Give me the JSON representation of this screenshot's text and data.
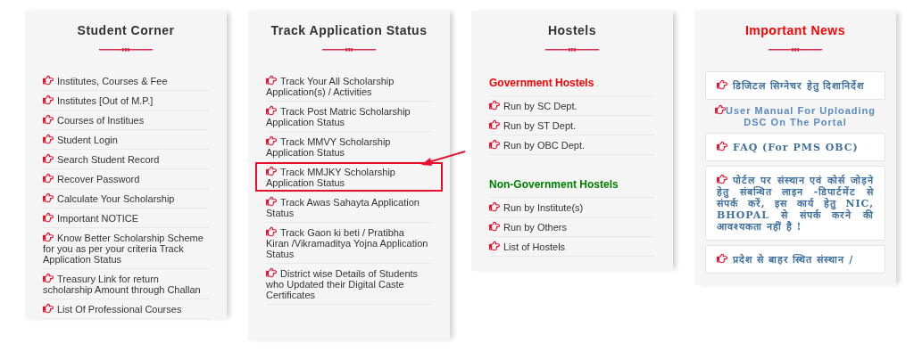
{
  "panels": [
    {
      "title": "Student Corner",
      "title_alert": false,
      "kind": "list",
      "sections": [
        {
          "items": [
            {
              "label": "Institutes, Courses & Fee",
              "highlighted": false
            },
            {
              "label": "Institutes [Out of M.P.]",
              "highlighted": false
            },
            {
              "label": "Courses of Institues",
              "highlighted": false
            },
            {
              "label": "Student Login",
              "highlighted": false
            },
            {
              "label": "Search Student Record",
              "highlighted": false
            },
            {
              "label": "Recover Password",
              "highlighted": false
            },
            {
              "label": "Calculate Your Scholarship",
              "highlighted": false
            },
            {
              "label": "Important NOTICE",
              "highlighted": false
            },
            {
              "label": "Know Better Scholarship Scheme for you as per your criteria Track Application Status",
              "highlighted": false
            },
            {
              "label": "Treasury Link for return scholarship Amount through Challan",
              "highlighted": false
            },
            {
              "label": "List Of Professional Courses",
              "highlighted": false
            }
          ]
        }
      ]
    },
    {
      "title": "Track Application Status",
      "title_alert": false,
      "kind": "list",
      "sections": [
        {
          "items": [
            {
              "label": "Track Your All Scholarship Application(s) / Activities",
              "highlighted": false
            },
            {
              "label": "Track Post Matric Scholarship Application Status",
              "highlighted": false
            },
            {
              "label": "Track MMVY Scholarship Application Status",
              "highlighted": false
            },
            {
              "label": "Track MMJKY Scholarship Application Status",
              "highlighted": true
            },
            {
              "label": "Track Awas Sahayta Application Status",
              "highlighted": false
            },
            {
              "label": "Track Gaon ki beti / Pratibha Kiran /Vikramaditya Yojna Application Status",
              "highlighted": false
            },
            {
              "label": "District wise Details of Students who Updated their Digital Caste Certificates",
              "highlighted": false
            }
          ]
        }
      ]
    },
    {
      "title": "Hostels",
      "title_alert": false,
      "kind": "list",
      "sections": [
        {
          "heading": "Government Hostels",
          "color": "#ff0000",
          "items": [
            {
              "label": "Run by SC Dept.",
              "highlighted": false
            },
            {
              "label": "Run by ST Dept.",
              "highlighted": false
            },
            {
              "label": "Run by OBC Dept.",
              "highlighted": false
            }
          ]
        },
        {
          "heading": "Non-Government Hostels",
          "color": "#008000",
          "items": [
            {
              "label": "Run by Institute(s)",
              "highlighted": false
            },
            {
              "label": "Run by Others",
              "highlighted": false
            },
            {
              "label": "List of Hostels",
              "highlighted": false
            }
          ]
        }
      ]
    },
    {
      "title": "Important News",
      "title_alert": true,
      "kind": "news",
      "news": [
        {
          "kind": "card",
          "text": "डिजिटल सिग्नेचर हेतु दिशानिर्देश"
        },
        {
          "kind": "plain",
          "text": "User Manual For Uploading DSC On The Portal"
        },
        {
          "kind": "card",
          "text": "FAQ (For PMS OBC)"
        },
        {
          "kind": "card",
          "text": "पोर्टल पर संस्थान एवं कोर्स जोड़ने हेतु संबन्धित लाइन -डिपार्टमेंट से संपर्क करें, इस कार्य हेतु NIC, BHOPAL से संपर्क करने की आवश्यकता नहीं है !"
        },
        {
          "kind": "card",
          "text": "प्रदेश से बाहर स्थित संस्थान /"
        }
      ]
    }
  ]
}
